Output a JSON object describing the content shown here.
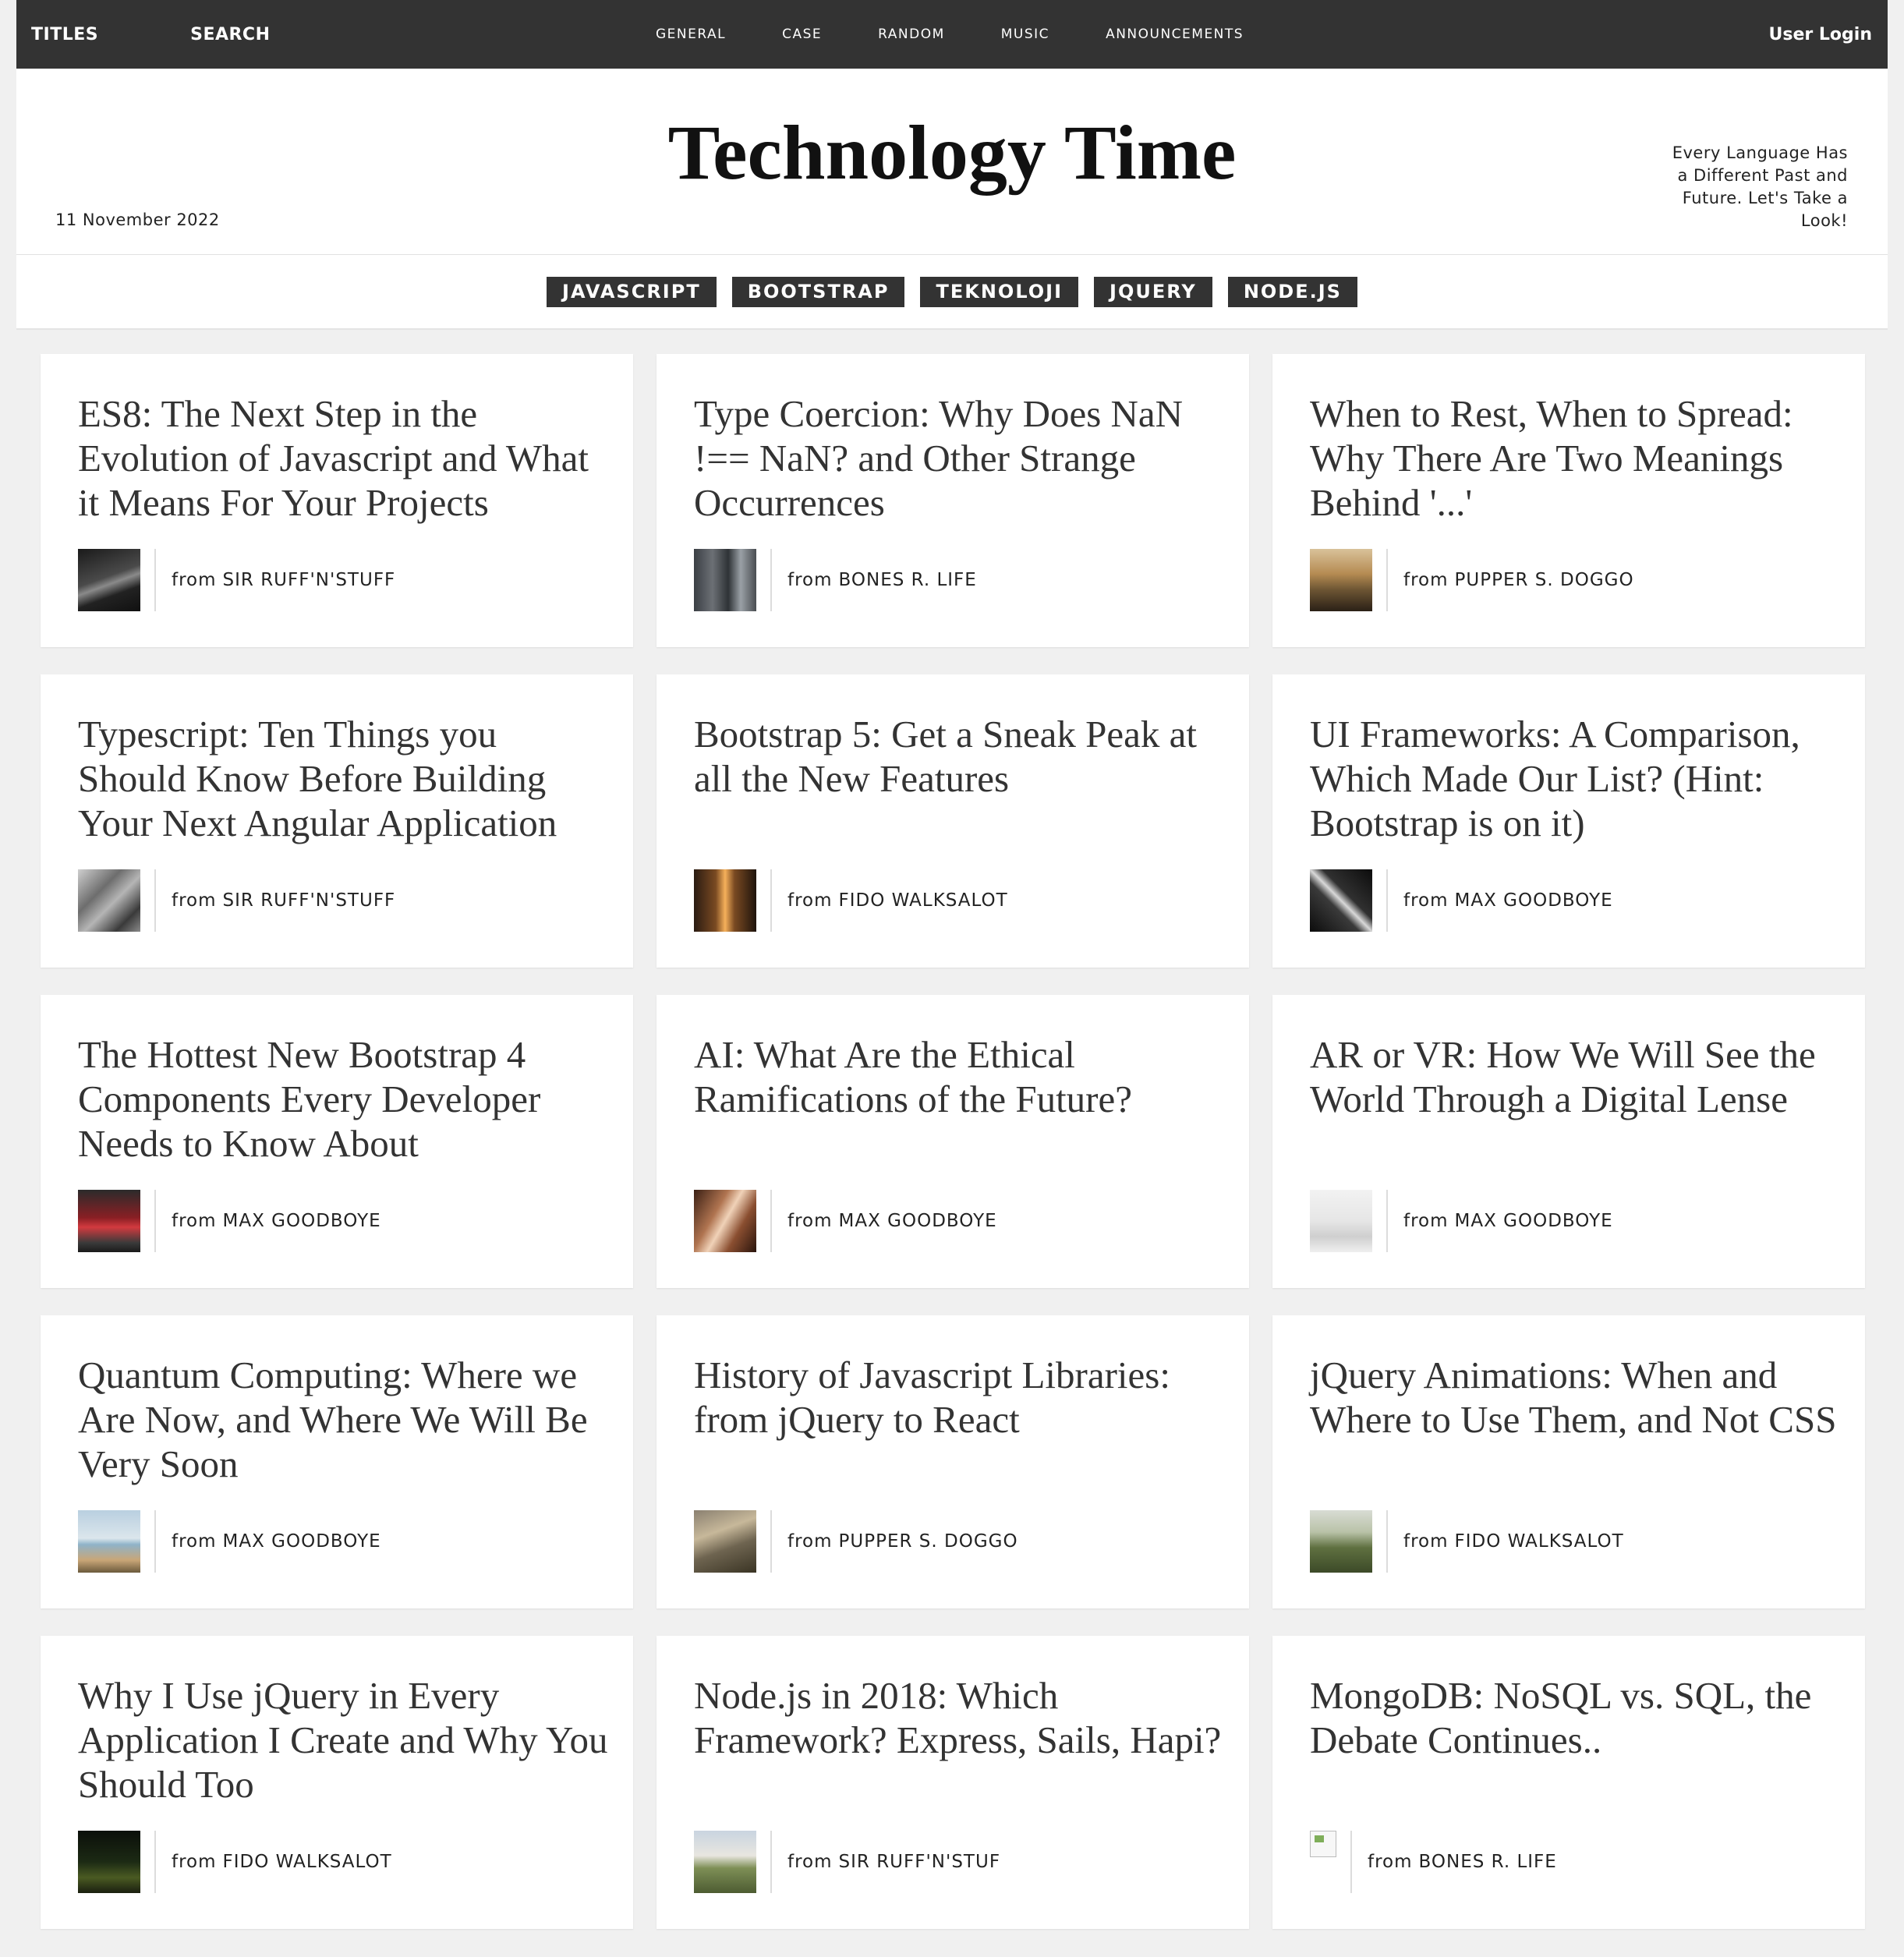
{
  "topnav": {
    "titles": "TITLES",
    "search": "SEARCH",
    "categories": [
      "GENERAL",
      "CASE",
      "RANDOM",
      "MUSIC",
      "ANNOUNCEMENTS"
    ],
    "login": "User Login"
  },
  "masthead": {
    "date": "11 November 2022",
    "title": "Technology Time",
    "tagline": "Every Language Has a Different Past and Future. Let's Take a Look!"
  },
  "tags": [
    "JAVASCRIPT",
    "BOOTSTRAP",
    "TEKNOLOJI",
    "JQUERY",
    "NODE.JS"
  ],
  "articles": [
    {
      "title": "ES8: The Next Step in the Evolution of Javascript and What it Means For Your Projects",
      "from": "from",
      "author": "SIR RUFF'N'STUFF",
      "thumb": "dark-road-photo"
    },
    {
      "title": "Type Coercion: Why Does NaN !== NaN? and Other Strange Occurrences",
      "from": "from",
      "author": "BONES R. LIFE",
      "thumb": "camera-gear-photo"
    },
    {
      "title": "When to Rest, When to Spread: Why There Are Two Meanings Behind '...'",
      "from": "from",
      "author": "PUPPER S. DOGGO",
      "thumb": "sunset-hills-photo"
    },
    {
      "title": "Typescript: Ten Things you Should Know Before Building Your Next Angular Application",
      "from": "from",
      "author": "SIR RUFF'N'STUFF",
      "thumb": "cyclists-photo"
    },
    {
      "title": "Bootstrap 5: Get a Sneak Peak at all the New Features",
      "from": "from",
      "author": "FIDO WALKSALOT",
      "thumb": "city-street-sunset-photo"
    },
    {
      "title": "UI Frameworks: A Comparison, Which Made Our List? (Hint: Bootstrap is on it)",
      "from": "from",
      "author": "MAX GOODBOYE",
      "thumb": "architecture-photo"
    },
    {
      "title": "The Hottest New Bootstrap 4 Components Every Developer Needs to Know About",
      "from": "from",
      "author": "MAX GOODBOYE",
      "thumb": "red-building-photo"
    },
    {
      "title": "AI: What Are the Ethical Ramifications of the Future?",
      "from": "from",
      "author": "MAX GOODBOYE",
      "thumb": "hands-photo"
    },
    {
      "title": "AR or VR: How We Will See the World Through a Digital Lense",
      "from": "from",
      "author": "MAX GOODBOYE",
      "thumb": "white-desk-photo"
    },
    {
      "title": "Quantum Computing: Where we Are Now, and Where We Will Be Very Soon",
      "from": "from",
      "author": "MAX GOODBOYE",
      "thumb": "beach-photo"
    },
    {
      "title": "History of Javascript Libraries: from jQuery to React",
      "from": "from",
      "author": "PUPPER S. DOGGO",
      "thumb": "field-grass-photo"
    },
    {
      "title": "jQuery Animations: When and Where to Use Them, and Not CSS",
      "from": "from",
      "author": "FIDO WALKSALOT",
      "thumb": "landscape-photo"
    },
    {
      "title": "Why I Use jQuery in Every Application I Create and Why You Should Too",
      "from": "from",
      "author": "FIDO WALKSALOT",
      "thumb": "night-sky-photo"
    },
    {
      "title": "Node.js in 2018: Which Framework? Express, Sails, Hapi?",
      "from": "from",
      "author": "SIR RUFF'N'STUF",
      "thumb": "green-hill-photo"
    },
    {
      "title": "MongoDB: NoSQL vs. SQL, the Debate Continues..",
      "from": "from",
      "author": "BONES R. LIFE",
      "thumb": "broken-image-icon"
    }
  ]
}
